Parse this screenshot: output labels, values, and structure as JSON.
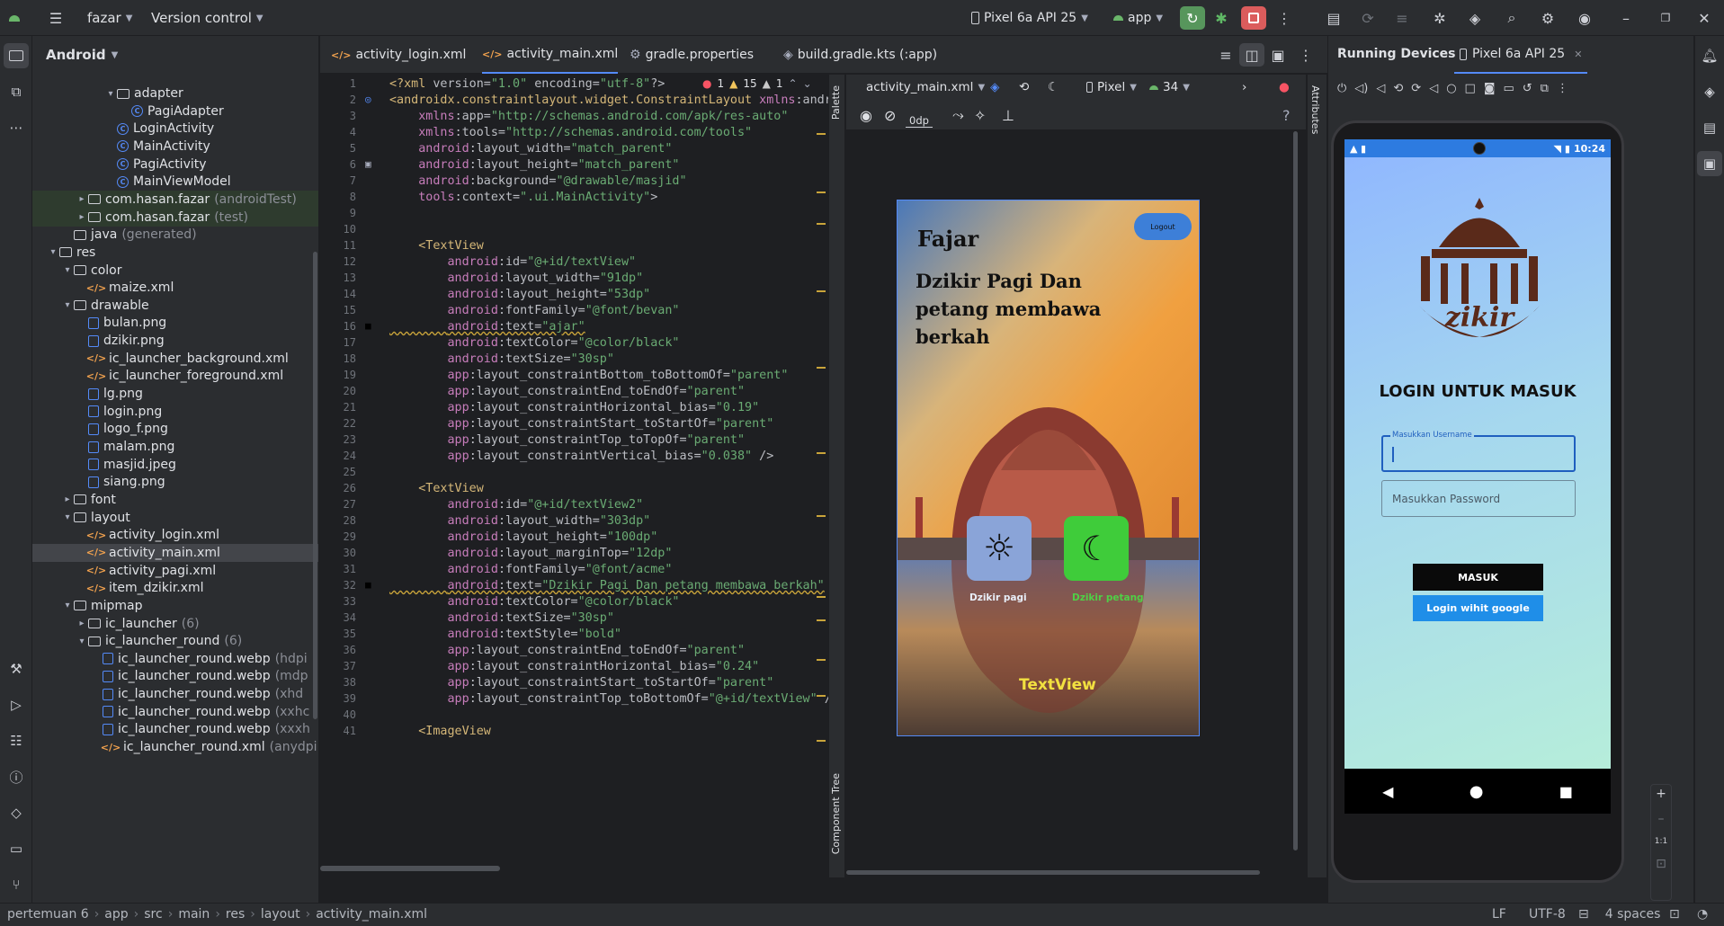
{
  "titlebar": {
    "project": "fazar",
    "vcs": "Version control",
    "device": "Pixel 6a API 25",
    "run_config": "app"
  },
  "project_panel": {
    "title": "Android",
    "rows": [
      {
        "label": "adapter",
        "type": "folder",
        "level": 4,
        "expanded": true
      },
      {
        "label": "PagiAdapter",
        "type": "class",
        "level": 5
      },
      {
        "label": "LoginActivity",
        "type": "class",
        "level": 4
      },
      {
        "label": "MainActivity",
        "type": "class",
        "level": 4
      },
      {
        "label": "PagiActivity",
        "type": "class",
        "level": 4
      },
      {
        "label": "MainViewModel",
        "type": "class",
        "level": 4
      },
      {
        "label": "com.hasan.fazar",
        "dim": "(androidTest)",
        "type": "folder",
        "level": 2,
        "collapsed": true
      },
      {
        "label": "com.hasan.fazar",
        "dim": "(test)",
        "type": "folder",
        "level": 2,
        "collapsed": true
      },
      {
        "label": "java",
        "dim": "(generated)",
        "type": "folder",
        "level": 1
      },
      {
        "label": "res",
        "type": "folder",
        "level": 0,
        "expanded": true
      },
      {
        "label": "color",
        "type": "folder",
        "level": 1,
        "expanded": true
      },
      {
        "label": "maize.xml",
        "type": "xml",
        "level": 2
      },
      {
        "label": "drawable",
        "type": "folder",
        "level": 1,
        "expanded": true
      },
      {
        "label": "bulan.png",
        "type": "png",
        "level": 2
      },
      {
        "label": "dzikir.png",
        "type": "png",
        "level": 2
      },
      {
        "label": "ic_launcher_background.xml",
        "type": "xml",
        "level": 2
      },
      {
        "label": "ic_launcher_foreground.xml",
        "type": "xml",
        "level": 2
      },
      {
        "label": "lg.png",
        "type": "png",
        "level": 2
      },
      {
        "label": "login.png",
        "type": "png",
        "level": 2
      },
      {
        "label": "logo_f.png",
        "type": "png",
        "level": 2
      },
      {
        "label": "malam.png",
        "type": "png",
        "level": 2
      },
      {
        "label": "masjid.jpeg",
        "type": "png",
        "level": 2
      },
      {
        "label": "siang.png",
        "type": "png",
        "level": 2
      },
      {
        "label": "font",
        "type": "folder",
        "level": 1,
        "collapsed": true
      },
      {
        "label": "layout",
        "type": "folder",
        "level": 1,
        "expanded": true
      },
      {
        "label": "activity_login.xml",
        "type": "xml",
        "level": 2
      },
      {
        "label": "activity_main.xml",
        "type": "xml",
        "level": 2,
        "selected": true
      },
      {
        "label": "activity_pagi.xml",
        "type": "xml",
        "level": 2
      },
      {
        "label": "item_dzikir.xml",
        "type": "xml",
        "level": 2
      },
      {
        "label": "mipmap",
        "type": "folder",
        "level": 1,
        "expanded": true
      },
      {
        "label": "ic_launcher",
        "dim": "(6)",
        "type": "folder",
        "level": 2,
        "collapsed": true
      },
      {
        "label": "ic_launcher_round",
        "dim": "(6)",
        "type": "folder",
        "level": 2,
        "expanded": true
      },
      {
        "label": "ic_launcher_round.webp",
        "dim": "(hdpi",
        "type": "png",
        "level": 3
      },
      {
        "label": "ic_launcher_round.webp",
        "dim": "(mdp",
        "type": "png",
        "level": 3
      },
      {
        "label": "ic_launcher_round.webp",
        "dim": "(xhd",
        "type": "png",
        "level": 3
      },
      {
        "label": "ic_launcher_round.webp",
        "dim": "(xxhc",
        "type": "png",
        "level": 3
      },
      {
        "label": "ic_launcher_round.webp",
        "dim": "(xxxh",
        "type": "png",
        "level": 3
      },
      {
        "label": "ic_launcher_round.xml",
        "dim": "(anydpi",
        "type": "xml",
        "level": 3
      }
    ]
  },
  "editor_tabs": [
    "activity_login.xml",
    "activity_main.xml",
    "gradle.properties",
    "build.gradle.kts (:app)"
  ],
  "inspection": {
    "errors": "1",
    "warnings": "15",
    "weak": "1"
  },
  "code_lines": [
    {
      "n": "1",
      "t": "<?xml version=\"1.0\" encoding=\"utf-8\"?>"
    },
    {
      "n": "2",
      "t": "<androidx.constraintlayout.widget.ConstraintLayout xmlns:andr"
    },
    {
      "n": "3",
      "t": "    xmlns:app=\"http://schemas.android.com/apk/res-auto\""
    },
    {
      "n": "4",
      "t": "    xmlns:tools=\"http://schemas.android.com/tools\""
    },
    {
      "n": "5",
      "t": "    android:layout_width=\"match_parent\""
    },
    {
      "n": "6",
      "t": "    android:layout_height=\"match_parent\""
    },
    {
      "n": "7",
      "t": "    android:background=\"@drawable/masjid\""
    },
    {
      "n": "8",
      "t": "    tools:context=\".ui.MainActivity\">"
    },
    {
      "n": "9",
      "t": ""
    },
    {
      "n": "10",
      "t": ""
    },
    {
      "n": "11",
      "t": "    <TextView"
    },
    {
      "n": "12",
      "t": "        android:id=\"@+id/textView\""
    },
    {
      "n": "13",
      "t": "        android:layout_width=\"91dp\""
    },
    {
      "n": "14",
      "t": "        android:layout_height=\"53dp\""
    },
    {
      "n": "15",
      "t": "        android:fontFamily=\"@font/bevan\""
    },
    {
      "n": "16",
      "t": "        android:text=\"ajar\""
    },
    {
      "n": "17",
      "t": "        android:textColor=\"@color/black\""
    },
    {
      "n": "18",
      "t": "        android:textSize=\"30sp\""
    },
    {
      "n": "19",
      "t": "        app:layout_constraintBottom_toBottomOf=\"parent\""
    },
    {
      "n": "20",
      "t": "        app:layout_constraintEnd_toEndOf=\"parent\""
    },
    {
      "n": "21",
      "t": "        app:layout_constraintHorizontal_bias=\"0.19\""
    },
    {
      "n": "22",
      "t": "        app:layout_constraintStart_toStartOf=\"parent\""
    },
    {
      "n": "23",
      "t": "        app:layout_constraintTop_toTopOf=\"parent\""
    },
    {
      "n": "24",
      "t": "        app:layout_constraintVertical_bias=\"0.038\" />"
    },
    {
      "n": "25",
      "t": ""
    },
    {
      "n": "26",
      "t": "    <TextView"
    },
    {
      "n": "27",
      "t": "        android:id=\"@+id/textView2\""
    },
    {
      "n": "28",
      "t": "        android:layout_width=\"303dp\""
    },
    {
      "n": "29",
      "t": "        android:layout_height=\"100dp\""
    },
    {
      "n": "30",
      "t": "        android:layout_marginTop=\"12dp\""
    },
    {
      "n": "31",
      "t": "        android:fontFamily=\"@font/acme\""
    },
    {
      "n": "32",
      "t": "        android:text=\"Dzikir Pagi Dan petang membawa berkah\""
    },
    {
      "n": "33",
      "t": "        android:textColor=\"@color/black\""
    },
    {
      "n": "34",
      "t": "        android:textSize=\"30sp\""
    },
    {
      "n": "35",
      "t": "        android:textStyle=\"bold\""
    },
    {
      "n": "36",
      "t": "        app:layout_constraintEnd_toEndOf=\"parent\""
    },
    {
      "n": "37",
      "t": "        app:layout_constraintHorizontal_bias=\"0.24\""
    },
    {
      "n": "38",
      "t": "        app:layout_constraintStart_toStartOf=\"parent\""
    },
    {
      "n": "39",
      "t": "        app:layout_constraintTop_toBottomOf=\"@+id/textView\" /"
    },
    {
      "n": "40",
      "t": ""
    },
    {
      "n": "41",
      "t": "    <ImageView"
    }
  ],
  "design": {
    "file": "activity_main.xml",
    "device": "Pixel",
    "api": "34",
    "margin": "0dp",
    "palette_label": "Palette",
    "component_tree_label": "Component Tree",
    "attributes_label": "Attributes",
    "preview": {
      "logo": "Fajar",
      "logout": "Logout",
      "headline": "Dzikir Pagi Dan petang membawa berkah",
      "pagi_label": "Dzikir pagi",
      "petang_label": "Dzikir petang",
      "textview": "TextView"
    }
  },
  "running_devices": {
    "title": "Running Devices",
    "tab": "Pixel 6a API 25",
    "status_time": "10:24",
    "screen": {
      "logo_text": "zikir",
      "heading": "LOGIN UNTUK MASUK",
      "username_label": "Masukkan Username",
      "password_placeholder": "Masukkan Password",
      "masuk_button": "MASUK",
      "google_button": "Login wihit google"
    },
    "zoom_label": "1:1"
  },
  "statusbar": {
    "breadcrumb": [
      "pertemuan 6",
      "app",
      "src",
      "main",
      "res",
      "layout",
      "activity_main.xml"
    ],
    "line_sep": "LF",
    "encoding": "UTF-8",
    "indent": "4 spaces"
  },
  "colors": {
    "accent": "#548af7",
    "run_green": "#57965c",
    "stop_red": "#db5c5c",
    "phone_bg_top": "#a4c8f5",
    "phone_bg_bottom": "#b8f0d8"
  }
}
